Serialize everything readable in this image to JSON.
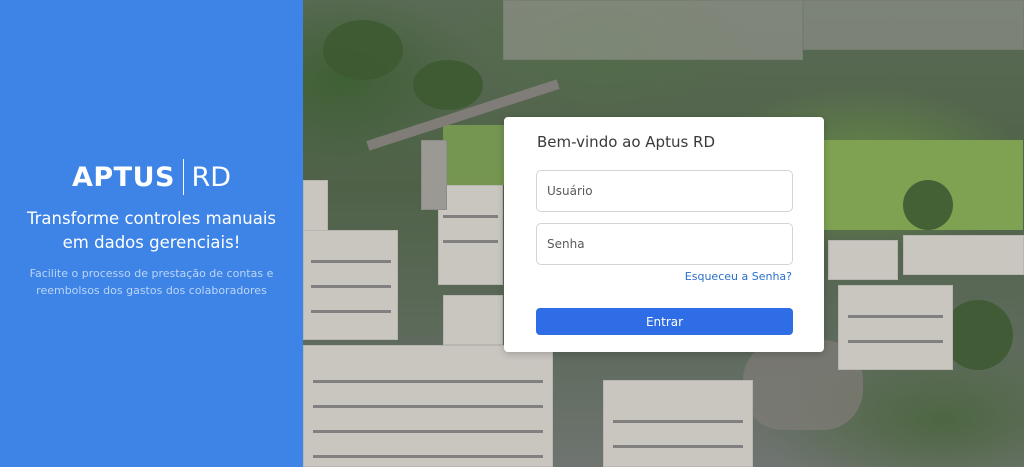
{
  "brand": {
    "logo_main": "APTUS",
    "logo_sub": "RD",
    "headline_line1": "Transforme controles manuais",
    "headline_line2": "em dados gerenciais!",
    "subline_line1": "Facilite o processo de prestação de contas e",
    "subline_line2": "reembolsos dos gastos dos colaboradores",
    "panel_color": "#3d84e6"
  },
  "login": {
    "title": "Bem-vindo ao Aptus RD",
    "username_placeholder": "Usuário",
    "password_placeholder": "Senha",
    "forgot_label": "Esqueceu a Senha?",
    "submit_label": "Entrar",
    "button_color": "#2f6de6"
  }
}
